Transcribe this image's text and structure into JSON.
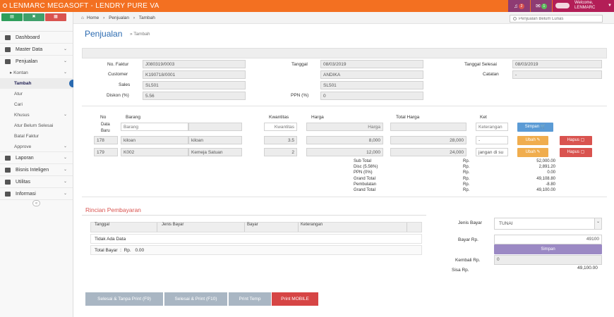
{
  "app": {
    "title": "LENMARC MEGASOFT - LENDRY PURE VA",
    "notif_count": "2",
    "mail_count": "1",
    "welcome": "Welcome,",
    "user": "LENMARC"
  },
  "breadcrumb": {
    "home": "Home",
    "sep": "›",
    "items": [
      "Penjualan",
      "Tambah"
    ]
  },
  "search": {
    "placeholder": "Penjualan Belum Lunas"
  },
  "page": {
    "title": "Penjualan",
    "subtitle": "» Tambah"
  },
  "sidebar": {
    "items": [
      {
        "label": "Dashboard",
        "icon": "dashboard-icon"
      },
      {
        "label": "Master Data",
        "icon": "database-icon"
      },
      {
        "label": "Penjualan",
        "icon": "cash-icon"
      }
    ],
    "sub": {
      "kontan": "Kontan",
      "tambah": "Tambah",
      "atur": "Atur",
      "cari": "Cari",
      "khusus": "Khusus",
      "atur_belum": "Atur Belum Selesai",
      "batal": "Batal Faktur",
      "approve": "Approve"
    },
    "bottom": [
      {
        "label": "Laporan",
        "icon": "book-icon"
      },
      {
        "label": "Bisnis Inteligen",
        "icon": "users-icon"
      },
      {
        "label": "Utilitas",
        "icon": "cogs-icon"
      },
      {
        "label": "Informasi",
        "icon": "info-icon"
      }
    ]
  },
  "header": {
    "no_faktur_label": "No. Faktur",
    "no_faktur": "J080319/0003",
    "tanggal_label": "Tanggal",
    "tanggal": "08/03/2019",
    "tgl_selesai_label": "Tanggal Selesai",
    "tgl_selesai": "08/03/2019",
    "customer_label": "Customer",
    "customer": "K190718/0001",
    "customer_name": "ANDIKA",
    "catatan_label": "Catatan",
    "catatan": "-",
    "sales_label": "Sales",
    "sales": "SL501",
    "sales2": "SL501",
    "diskon_label": "Diskon (%)",
    "diskon": "5.56",
    "ppn_label": "PPN (%)",
    "ppn": "0"
  },
  "items_table": {
    "col_no": "No",
    "col_barang": "Barang",
    "col_qty": "Kwantitas",
    "col_harga": "Harga",
    "col_total": "Total Harga",
    "col_ket": "Ket",
    "new_label": "Data\nBaru",
    "ph_barang": "Barang",
    "ph_qty": "Kwantitas",
    "ph_harga": "Harga",
    "ph_ket": "Keterangan",
    "save_label": "Simpan",
    "rows": [
      {
        "no": "178",
        "code": "kiloan",
        "name": "kiloan",
        "qty": "3.5",
        "harga": "8,000",
        "total": "28,000",
        "ket": "-"
      },
      {
        "no": "179",
        "code": "K002",
        "name": "Kemeja Satuan",
        "qty": "2",
        "harga": "12,000",
        "total": "24,000",
        "ket": "jangan di su"
      }
    ],
    "edit_label": "Ubah",
    "delete_label": "Hapus"
  },
  "summary": {
    "rp": "Rp.",
    "rows": [
      {
        "label": "Sub Total",
        "value": "52,000.00"
      },
      {
        "label": "Disc (5.56%)",
        "value": "2,891.20"
      },
      {
        "label": "PPN (0%)",
        "value": "0.00"
      },
      {
        "label": "Grand Total",
        "value": "49,108.80"
      },
      {
        "label": "Pembulatan",
        "value": "-8.80"
      },
      {
        "label": "Grand Total",
        "value": "49,100.00"
      }
    ]
  },
  "payment": {
    "section_title": "Rincian Pembayaran",
    "col_tanggal": "Tanggal",
    "col_jenis": "Jenis Bayar",
    "col_bayar": "Bayar",
    "col_ket": "Keterangan",
    "empty": "Tidak Ada Data",
    "total_label": "Total Bayar",
    "total_rp": "Rp.",
    "total_value": "0.00",
    "jenis_label": "Jenis Bayar",
    "jenis_value": "TUNAI",
    "bayar_label": "Bayar Rp.",
    "bayar_value": "49100",
    "simpan": "Simpan",
    "kembali_label": "Kembali Rp.",
    "kembali_value": "0",
    "sisa_label": "Sisa Rp.",
    "sisa_value": "49,100.00"
  },
  "actions": {
    "b1": "Selesai & Tanpa Print (F9)",
    "b2": "Selesai & Print (F10)",
    "b3": "Print Temp",
    "b4": "Print MOBILE"
  },
  "colors": {
    "orange": "#f37021",
    "purple": "#8e3b73",
    "crimson": "#b31e57",
    "blue": "#5b9bd5",
    "amber": "#f0ad4e",
    "red": "#d9534f",
    "lavender": "#9b89c4",
    "grey_btn": "#a9b6c3",
    "print_red": "#d64545"
  }
}
